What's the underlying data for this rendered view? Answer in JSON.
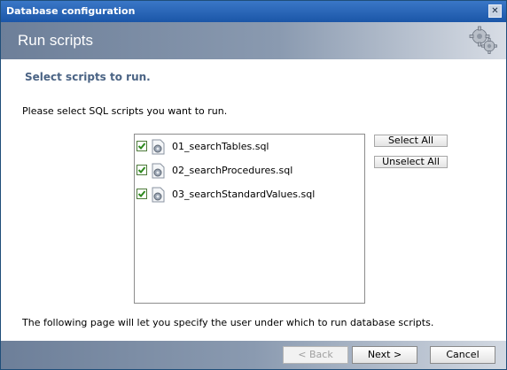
{
  "window": {
    "title": "Database configuration",
    "close_glyph": "✕"
  },
  "header": {
    "title": "Run scripts",
    "icon": "gears-icon"
  },
  "main": {
    "section_title": "Select scripts to run.",
    "instructions": "Please select SQL scripts you want to run.",
    "scripts": [
      {
        "label": "01_searchTables.sql",
        "checked": true
      },
      {
        "label": "02_searchProcedures.sql",
        "checked": true
      },
      {
        "label": "03_searchStandardValues.sql",
        "checked": true
      }
    ],
    "select_all_label": "Select All",
    "unselect_all_label": "Unselect All",
    "footer_note": "The following page will let you specify the user under which to run database scripts."
  },
  "nav": {
    "back_label": "< Back",
    "next_label": "Next >",
    "cancel_label": "Cancel"
  },
  "colors": {
    "titlebar": "#1b56a8",
    "header": "#8a9ab0",
    "section_title": "#4a6384",
    "checkmark": "#2f8a1f"
  }
}
